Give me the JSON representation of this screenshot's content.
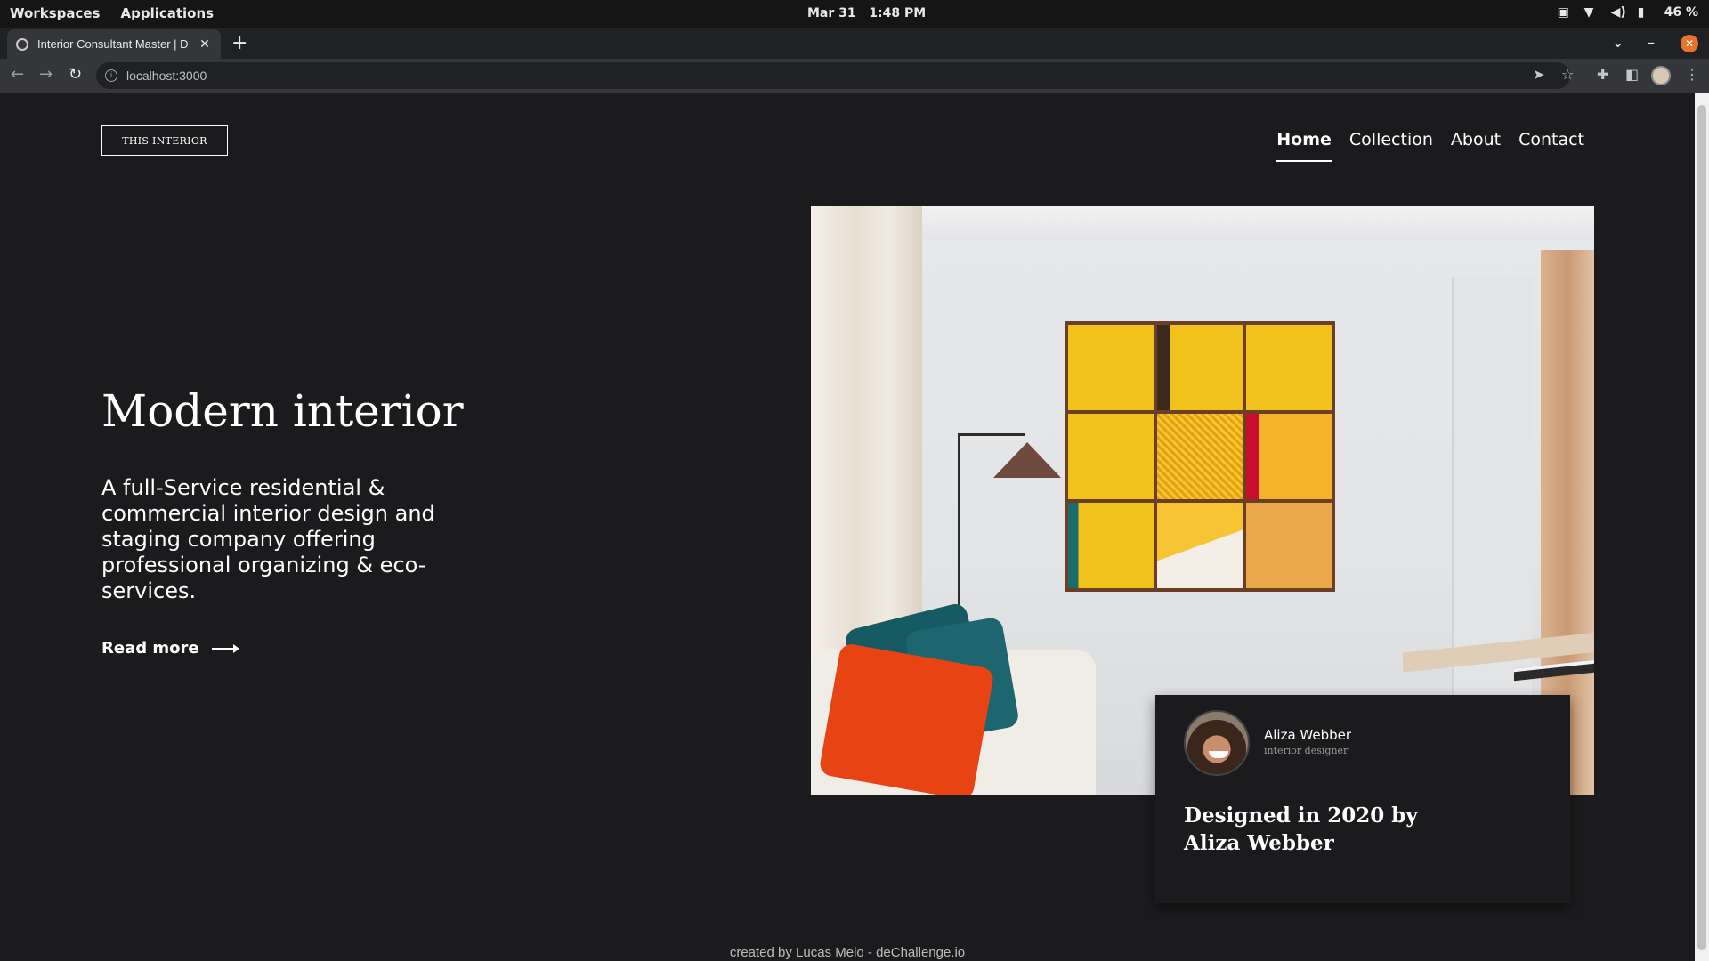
{
  "os": {
    "workspaces": "Workspaces",
    "applications": "Applications",
    "date": "Mar 31",
    "time": "1:48 PM",
    "battery": "46 %"
  },
  "browser": {
    "tab_title": "Interior Consultant Master | D",
    "url": "localhost:3000"
  },
  "site": {
    "logo": "THIS INTERIOR",
    "nav": {
      "home": "Home",
      "collection": "Collection",
      "about": "About",
      "contact": "Contact"
    },
    "hero": {
      "title": "Modern interior",
      "description": "A full-Service residential & commercial interior design and staging company offering professional organizing & eco-services.",
      "read_more": "Read more"
    },
    "card": {
      "name": "Aliza Webber",
      "role": "interior designer",
      "designed": "Designed in 2020 by Aliza Webber"
    },
    "footer": "created by Lucas Melo - deChallenge.io"
  }
}
